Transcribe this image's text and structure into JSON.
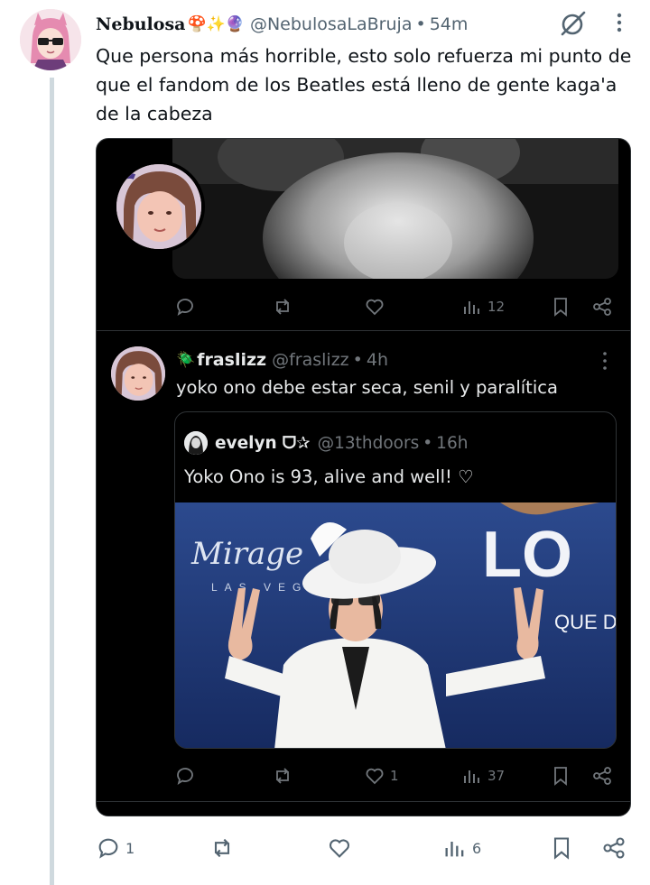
{
  "tweet": {
    "display_name": "Nebulosa",
    "name_emojis": "🍄✨🔮",
    "handle": "@NebulosaLaBruja",
    "separator": "•",
    "time": "54m",
    "text": "Que persona más horrible, esto solo refuerza mi punto de que el fandom de los Beatles está lleno de gente kaga'a de la cabeza",
    "actions": {
      "reply_count": "1",
      "repost_count": "",
      "like_count": "",
      "views_count": "6"
    }
  },
  "embedded_screenshot": {
    "top_post_actions": {
      "reply_count": "",
      "repost_count": "",
      "like_count": "",
      "views_count": "12"
    },
    "reply": {
      "name_emoji": "🪲",
      "display_name": "fraslizz",
      "handle": "@fraslizz",
      "separator": "•",
      "time": "4h",
      "text": "yoko ono debe estar seca, senil y paralítica"
    },
    "quoted": {
      "display_name": "evelyn",
      "name_symbols": "ᗜ✰",
      "handle": "@13thdoors",
      "separator": "•",
      "time": "16h",
      "text": "Yoko Ono is 93, alive and well! ♡"
    },
    "reply_actions": {
      "reply_count": "",
      "repost_count": "",
      "like_count": "1",
      "views_count": "37"
    },
    "photo_backdrop_text": {
      "brand": "Mirage",
      "brand_sub": "LAS VEGAS",
      "show_logo": "LO",
      "show_sub": "QUE D"
    }
  },
  "colors": {
    "accent_muted": "#536471",
    "dark_bg": "#000000",
    "dark_text": "#e7e9ea",
    "dark_muted": "#71767b",
    "thread_line": "#cfd9de",
    "backdrop_blue": "#1f3a7a"
  }
}
